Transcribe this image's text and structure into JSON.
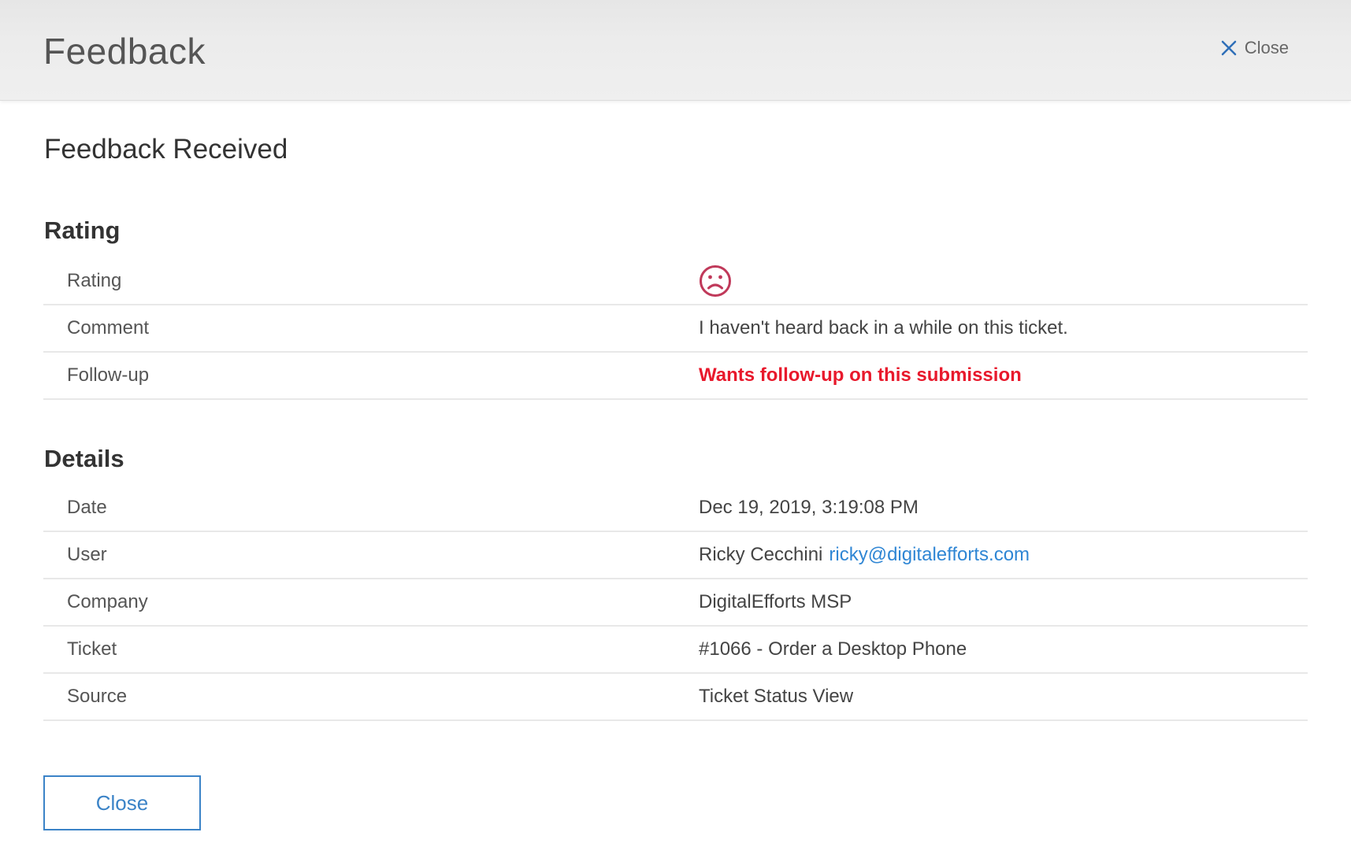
{
  "header": {
    "title": "Feedback",
    "close_label": "Close"
  },
  "page_title": "Feedback Received",
  "rating_section": {
    "heading": "Rating",
    "rows": [
      {
        "label": "Rating",
        "value_icon": "frown-face-icon",
        "icon_color": "#c0395a"
      },
      {
        "label": "Comment",
        "value": "I haven't heard back in a while on this ticket."
      },
      {
        "label": "Follow-up",
        "value": "Wants follow-up on this submission"
      }
    ]
  },
  "details_section": {
    "heading": "Details",
    "rows": [
      {
        "label": "Date",
        "value": "Dec 19, 2019, 3:19:08 PM"
      },
      {
        "label": "User",
        "value": "Ricky Cecchini",
        "link": "ricky@digitalefforts.com"
      },
      {
        "label": "Company",
        "value": "DigitalEfforts MSP"
      },
      {
        "label": "Ticket",
        "value": "#1066 - Order a Desktop Phone"
      },
      {
        "label": "Source",
        "value": "Ticket Status View"
      }
    ]
  },
  "footer": {
    "close_button_label": "Close"
  },
  "colors": {
    "accent": "#3b83c7",
    "link": "#2f86d4",
    "followup": "#e8192c"
  }
}
